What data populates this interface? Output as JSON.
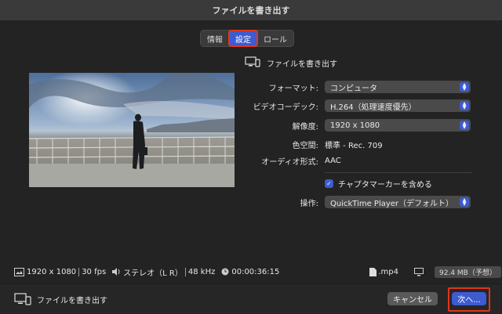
{
  "window": {
    "title": "ファイルを書き出す"
  },
  "tabs": [
    {
      "label": "情報"
    },
    {
      "label": "設定"
    },
    {
      "label": "ロール"
    }
  ],
  "destination": {
    "label": "ファイルを書き出す",
    "icon": "computer-icon"
  },
  "settings": {
    "format": {
      "label": "フォーマット:",
      "value": "コンピュータ"
    },
    "codec": {
      "label": "ビデオコーデック:",
      "value": "H.264（処理速度優先）"
    },
    "resolution": {
      "label": "解像度:",
      "value": "1920 x 1080"
    },
    "color_space": {
      "label": "色空間:",
      "value": "標準 - Rec. 709"
    },
    "audio_format": {
      "label": "オーディオ形式:",
      "value": "AAC"
    },
    "chapter_markers": {
      "label": "チャプタマーカーを含める",
      "checked": true
    },
    "action": {
      "label": "操作:",
      "value": "QuickTime Player（デフォルト）"
    }
  },
  "info": {
    "resolution": "1920 x 1080",
    "fps": "30 fps",
    "audio": "ステレオ（L R）",
    "sample_rate": "48 kHz",
    "duration": "00:00:36:15",
    "extension": ".mp4",
    "size": "92.4 MB（予想）"
  },
  "footer": {
    "destination_label": "ファイルを書き出す",
    "cancel": "キャンセル",
    "next": "次へ..."
  },
  "colors": {
    "accent": "#3f5bd0",
    "highlight": "#e0361a"
  }
}
